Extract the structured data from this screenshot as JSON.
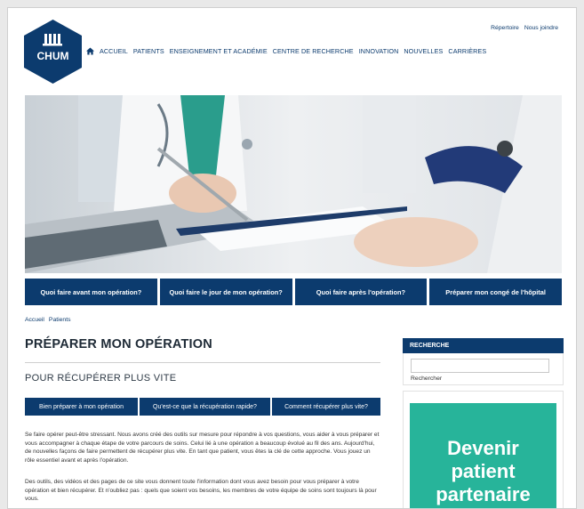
{
  "brand": {
    "name": "CHUM",
    "color": "#0c3b6e"
  },
  "utility_links": [
    "Répertoire",
    "Nous joindre"
  ],
  "nav": [
    "ACCUEIL",
    "PATIENTS",
    "ENSEIGNEMENT ET ACADÉMIE",
    "CENTRE DE RECHERCHE",
    "INNOVATION",
    "NOUVELLES",
    "CARRIÈRES"
  ],
  "tiles": [
    "Quoi faire avant mon opération?",
    "Quoi faire le jour de mon opération?",
    "Quoi faire après l'opération?",
    "Préparer mon congé de l'hôpital"
  ],
  "breadcrumb": [
    "Accueil",
    "Patients"
  ],
  "page_title": "PRÉPARER MON OPÉRATION",
  "section_title": "POUR RÉCUPÉRER PLUS VITE",
  "subtabs": [
    "Bien préparer à mon opération",
    "Qu'est-ce que la récupération rapide?",
    "Comment récupérer plus vite?"
  ],
  "paragraphs": [
    "Se faire opérer peut-être stressant. Nous avons créé des outils sur mesure pour répondre à vos questions, vous aider à vous préparer et vous accompagner à chaque étape de votre parcours de soins. Celui lié à une opération a beaucoup évolué au fil des ans. Aujourd'hui, de nouvelles façons de faire permettent de récupérer plus vite. En tant que patient, vous êtes la clé de cette approche. Vous jouez un rôle essentiel avant et après l'opération.",
    "Des outils, des vidéos et des pages de ce site vous donnent toute l'information dont vous avez besoin pour vous préparer à votre opération et bien récupérer. Et n'oubliez pas : quels que soient vos besoins, les membres de votre équipe de soins sont toujours là pour vous."
  ],
  "sidebar": {
    "search_heading": "RECHERCHE",
    "search_value": "",
    "search_button": "Rechercher",
    "promo_lines": [
      "Devenir",
      "patient",
      "partenaire"
    ],
    "promo_color": "#27b49a"
  },
  "icons": {
    "home": "home-icon",
    "logo": "chum-logo"
  }
}
